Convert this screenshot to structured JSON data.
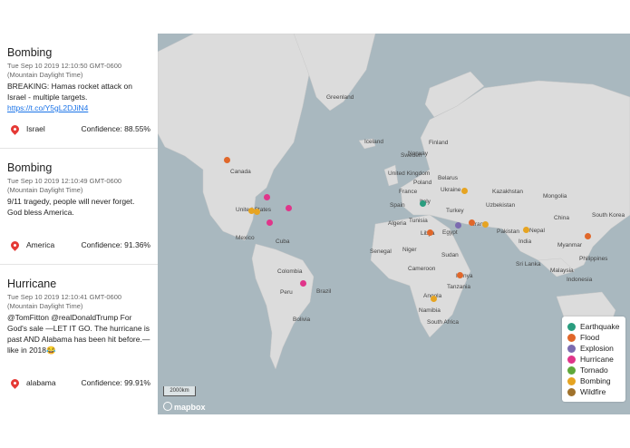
{
  "cards": [
    {
      "title": "Bombing",
      "time": "Tue Sep 10 2019 12:10:50 GMT-0600 (Mountain Daylight Time)",
      "text": "BREAKING: Hamas rocket attack on Israel - multiple targets.",
      "link": "https://t.co/Y5gL2DJiN4",
      "location": "Israel",
      "confidence": "Confidence: 88.55%"
    },
    {
      "title": "Bombing",
      "time": "Tue Sep 10 2019 12:10:49 GMT-0600 (Mountain Daylight Time)",
      "text": "9/11 tragedy, people will never forget. God bless America.",
      "location": "America",
      "confidence": "Confidence: 91.36%"
    },
    {
      "title": "Hurricane",
      "time": "Tue Sep 10 2019 12:10:41 GMT-0600 (Mountain Daylight Time)",
      "text": "@TomFitton @realDonaldTrump For God's sale —LET IT GO. The hurricane is past AND Alabama has been hit before.— like in 2018😂",
      "location": "alabama",
      "confidence": "Confidence: 99.91%"
    }
  ],
  "map": {
    "labels": [
      "Greenland",
      "Iceland",
      "Sweden",
      "Finland",
      "Norway",
      "Canada",
      "United Kingdom",
      "Poland",
      "Belarus",
      "Ukraine",
      "Kazakhstan",
      "Mongolia",
      "France",
      "Spain",
      "Italy",
      "Turkey",
      "Uzbekistan",
      "China",
      "South Korea",
      "United States",
      "Tunisia",
      "Iran",
      "Pakistan",
      "Nepal",
      "India",
      "Mexico",
      "Cuba",
      "Algeria",
      "Libya",
      "Egypt",
      "Myanmar",
      "Philippines",
      "Senegal",
      "Niger",
      "Sudan",
      "Sri Lanka",
      "Malaysia",
      "Colombia",
      "Cameroon",
      "Kenya",
      "Brazil",
      "Peru",
      "Tanzania",
      "Angola",
      "Bolivia",
      "Namibia",
      "South Africa",
      "Indonesia"
    ],
    "scale": "2000km",
    "attribution": "mapbox"
  },
  "legend": [
    {
      "label": "Earthquake",
      "color": "#2a9d7f"
    },
    {
      "label": "Flood",
      "color": "#e0672a"
    },
    {
      "label": "Explosion",
      "color": "#7b6bb0"
    },
    {
      "label": "Hurricane",
      "color": "#e0358a"
    },
    {
      "label": "Tornado",
      "color": "#5fa83a"
    },
    {
      "label": "Bombing",
      "color": "#e6a422"
    },
    {
      "label": "Wildfire",
      "color": "#a0722c"
    }
  ]
}
